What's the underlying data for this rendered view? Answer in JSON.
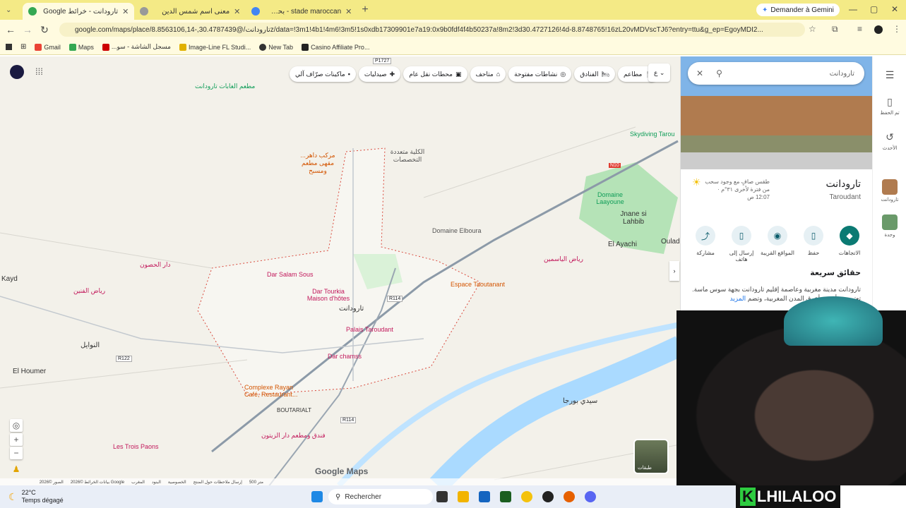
{
  "browser": {
    "tabs": [
      {
        "title": "تارودانت - خرائط Google",
        "active": true
      },
      {
        "title": "معنى اسم شمس الدين",
        "active": false
      },
      {
        "title": "stade maroccan - بحث Google",
        "active": false
      }
    ],
    "new_tab": "+",
    "gemini_button": "Demander à Gemini",
    "url": "google.com/maps/place/تارودانت/@30.4787439,-8.8563106,14z/data=!3m1!4b1!4m6!3m5!1s0xdb17309901e7a19:0x9b0fdf4f4b50237a!8m2!3d30.4727126!4d-8.8748765!16zL20vMDVscTJ6?entry=ttu&g_ep=EgoyMDI2...",
    "bookmarks": [
      "Gmail",
      "Maps",
      "...مسجل الشاشة - سو",
      "Image-Line FL Studi...",
      "New Tab",
      "Casino Affiliate Pro..."
    ]
  },
  "map": {
    "chips": [
      "مطاعم",
      "الفنادق",
      "نشاطات مفتوحة",
      "متاحف",
      "محطات نقل عام",
      "صيدليات",
      "ماكينات صرّاف آلي"
    ],
    "labels": [
      {
        "text": "مطعم الغابات تارودانت",
        "cls": "poi-green"
      },
      {
        "text": "Skydiving Tarou",
        "cls": "poi-green"
      },
      {
        "text": "Domaine Laayoune",
        "cls": "poi-green"
      },
      {
        "text": "Jnane si Lahbib",
        "cls": "town"
      },
      {
        "text": "El Ayachi",
        "cls": "town"
      },
      {
        "text": "Oulad",
        "cls": "town"
      },
      {
        "text": "Domaine Elboura",
        "cls": "poi-gray"
      },
      {
        "text": "رياض الياسمين",
        "cls": "poi-pink"
      },
      {
        "text": "Espace Taoutanant",
        "cls": "poi-orange"
      },
      {
        "text": "Dar Salam Sous",
        "cls": "poi-pink"
      },
      {
        "text": "Dar Tourkia Maison d'hôtes",
        "cls": "poi-pink"
      },
      {
        "text": "Palais Taroudant",
        "cls": "poi-pink"
      },
      {
        "text": "Dar chamss",
        "cls": "poi-pink"
      },
      {
        "text": "تارودانت",
        "cls": "town"
      },
      {
        "text": "دار الحصون",
        "cls": "poi-pink"
      },
      {
        "text": "رياض الفنين",
        "cls": "poi-pink"
      },
      {
        "text": "Kayd",
        "cls": "town"
      },
      {
        "text": "El Houmer",
        "cls": "town"
      },
      {
        "text": "النوايل",
        "cls": "town"
      },
      {
        "text": "Complexe Rayan Café, Restaurant...",
        "cls": "poi-orange"
      },
      {
        "text": "BOUTARIALT",
        "cls": "town"
      },
      {
        "text": "سيدي بورجا",
        "cls": "town"
      },
      {
        "text": "فندق ومطعم دار الزيتون",
        "cls": "poi-pink"
      },
      {
        "text": "Les Trois Paons",
        "cls": "poi-pink"
      },
      {
        "text": "...مركب داهر مقهى مطعم ومسبح",
        "cls": "poi-orange"
      },
      {
        "text": "الكلية متعددة التخصصات",
        "cls": "poi-gray"
      }
    ],
    "road_labels": [
      "P1727",
      "N10",
      "R114",
      "R122",
      "R114"
    ],
    "zoom_in": "+",
    "zoom_out": "−",
    "attribution": [
      "الصور ©2026",
      "بيانات الخرائط ©2026 Google",
      "المغرب",
      "البنود",
      "الخصوصية",
      "إرسال ملاحظات حول المنتج",
      "500 متر"
    ],
    "brand": "Google Maps",
    "layers_label": "طبقات"
  },
  "panel": {
    "search_value": "تارودانت",
    "name_ar": "تارودانت",
    "name_lat": "Taroudant",
    "weather": "طقس صافٍ مع وجود سحب\nمن فترة لأخرى ٣١°م · \n12:07 ص",
    "actions": [
      {
        "label": "الاتجاهات",
        "icon": "directions-icon"
      },
      {
        "label": "حفظ",
        "icon": "bookmark-icon"
      },
      {
        "label": "المواقع القريبة",
        "icon": "nearby-icon"
      },
      {
        "label": "إرسال إلى هاتف",
        "icon": "phone-icon"
      },
      {
        "label": "مشاركة",
        "icon": "share-icon"
      }
    ],
    "facts_title": "حقائق سريعة",
    "facts_text": "تارودانت مدينة مغربية وعاصمة إقليم تارودانت بجهة سوس ماسة. تعتبر من أقدم وأعرق المدن المغربية، وتضم",
    "more": "المزيد"
  },
  "rail": {
    "items": [
      "تم الحفظ",
      "الأحدث",
      "تارودانت",
      "وجدة"
    ]
  },
  "taskbar": {
    "temp": "22°C",
    "weather": "Temps dégagé",
    "search": "Rechercher"
  },
  "overlay": {
    "logo_k": "K",
    "logo_text": "LHILALOO"
  }
}
